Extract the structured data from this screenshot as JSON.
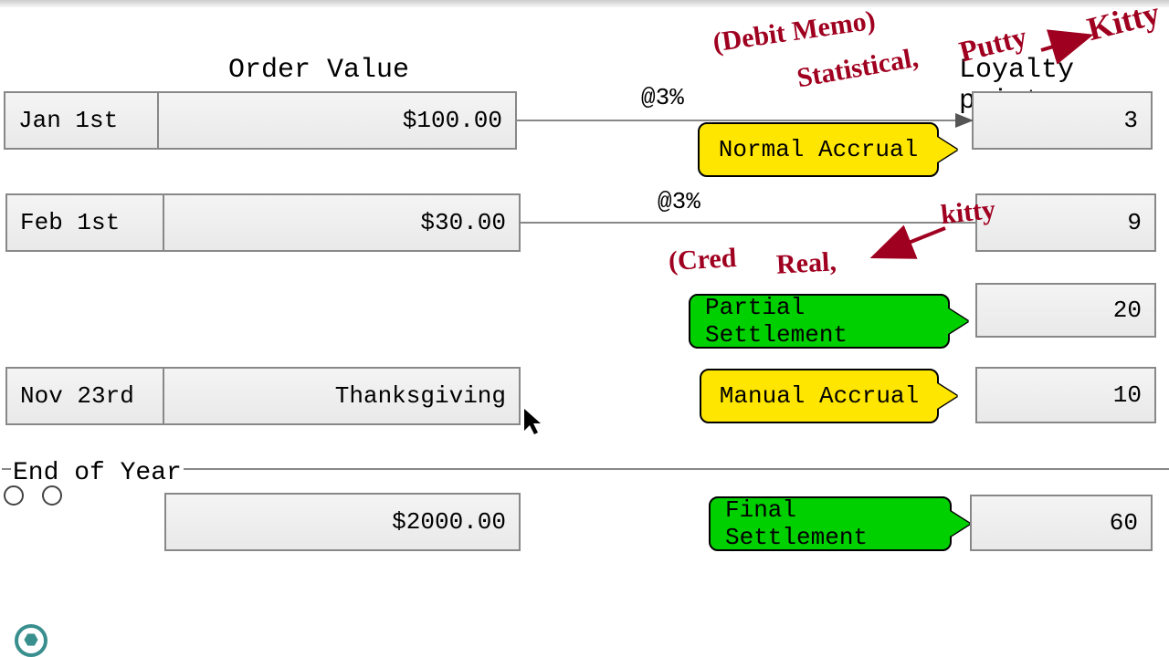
{
  "headings": {
    "order_value": "Order Value",
    "loyalty_points": "Loyalty points",
    "end_of_year": "End of Year"
  },
  "rates": {
    "row1": "@3%",
    "row2": "@3%"
  },
  "rows": [
    {
      "date": "Jan 1st",
      "value": "$100.00",
      "points": "3"
    },
    {
      "date": "Feb 1st",
      "value": "$30.00",
      "points": "9"
    },
    {
      "date": "Nov 23rd",
      "value": "Thanksgiving",
      "points": "10"
    }
  ],
  "points": {
    "partial": "20",
    "final": "60"
  },
  "eoy_value": "$2000.00",
  "pills": {
    "normal": "Normal Accrual",
    "partial": "Partial Settlement",
    "manual": "Manual Accrual",
    "final": "Final Settlement"
  },
  "handwriting": {
    "debit_memo": "(Debit Memo)",
    "statistical": "Statistical,",
    "putty": "Putty",
    "kitty1": "Kitty",
    "cred": "(Cred",
    "real": "Real,",
    "kitty2": "kitty"
  },
  "colors": {
    "yellow": "#ffe600",
    "green": "#00d000",
    "ink": "#a00020",
    "teal": "#398e8e"
  }
}
